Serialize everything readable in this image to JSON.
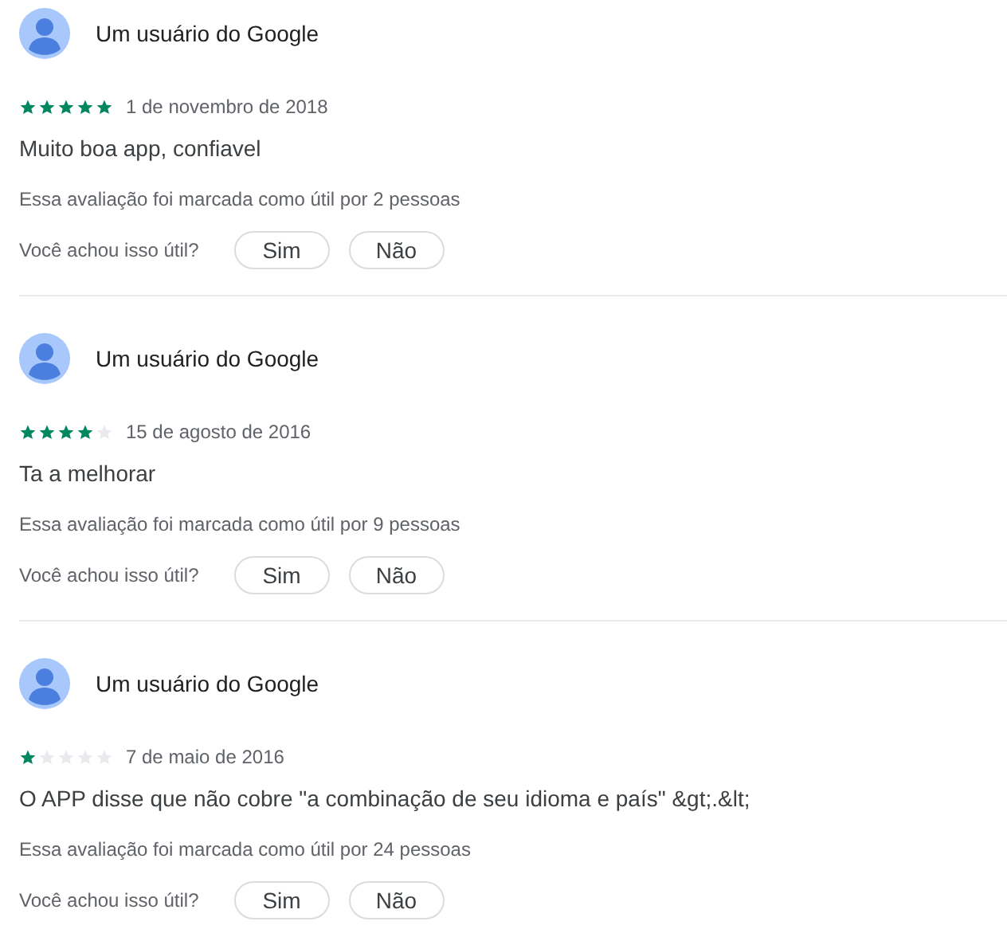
{
  "reviews": [
    {
      "author": "Um usuário do Google",
      "stars": 5,
      "date": "1 de novembro de 2018",
      "text": "Muito boa app, confiavel",
      "helpful_count": "Essa avaliação foi marcada como útil por 2 pessoas",
      "question": "Você achou isso útil?",
      "buttons": [
        "Sim",
        "Não"
      ]
    },
    {
      "author": "Um usuário do Google",
      "stars": 4,
      "date": "15 de agosto de 2016",
      "text": "Ta a melhorar",
      "helpful_count": "Essa avaliação foi marcada como útil por 9 pessoas",
      "question": "Você achou isso útil?",
      "buttons": [
        "Sim",
        "Não"
      ]
    },
    {
      "author": "Um usuário do Google",
      "stars": 1,
      "date": "7 de maio de 2016",
      "text": "O APP disse que não cobre \"a combinação de seu idioma e país\" &gt;.&lt;",
      "helpful_count": "Essa avaliação foi marcada como útil por 24 pessoas",
      "question": "Você achou isso útil?",
      "buttons": [
        "Sim",
        "Não"
      ]
    }
  ]
}
